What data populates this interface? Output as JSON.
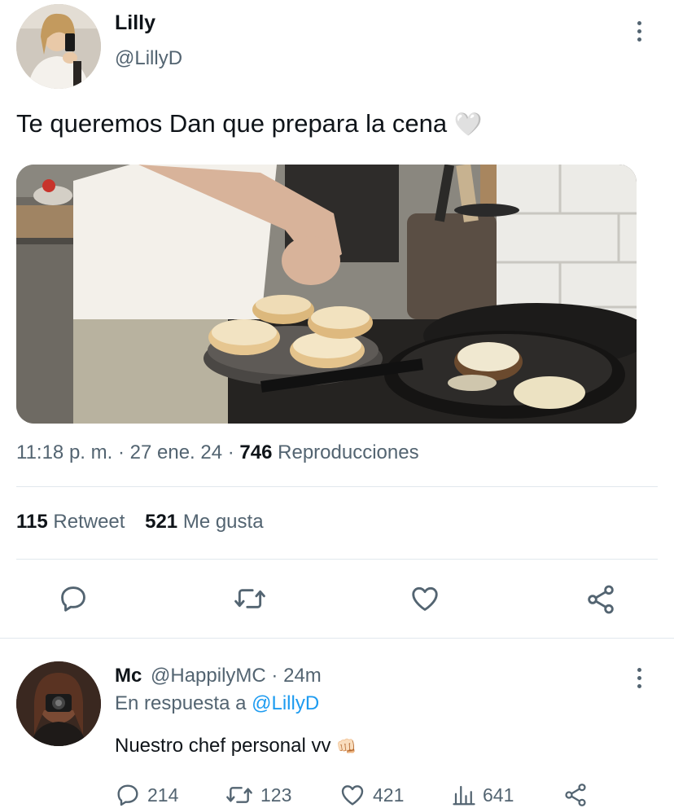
{
  "tweet": {
    "author_name": "Lilly",
    "author_handle": "@LillyD",
    "text": "Te queremos Dan que prepara la cena",
    "emoji": "🤍",
    "time": "11:18 p. m.",
    "date": "27 ene. 24",
    "views_count": "746",
    "views_label": "Reproducciones",
    "retweets_count": "115",
    "retweets_label": "Retweet",
    "likes_count": "521",
    "likes_label": "Me gusta",
    "sep": "·"
  },
  "actions": {
    "icons": [
      "reply-icon",
      "retweet-icon",
      "like-icon",
      "share-icon"
    ]
  },
  "reply": {
    "author_name": "Mc",
    "author_handle": "@HappilyMC",
    "time": "24m",
    "sep": "·",
    "in_reply_prefix": "En respuesta a",
    "in_reply_handle": "@LillyD",
    "text": "Nuestro chef personal vv",
    "emoji": "👊🏻",
    "reply_count": "214",
    "retweet_count": "123",
    "like_count": "421",
    "views_count": "641"
  },
  "colors": {
    "link": "#1d9bf0",
    "muted": "#536471",
    "text": "#0f1419",
    "divider": "#e1e8ed"
  }
}
